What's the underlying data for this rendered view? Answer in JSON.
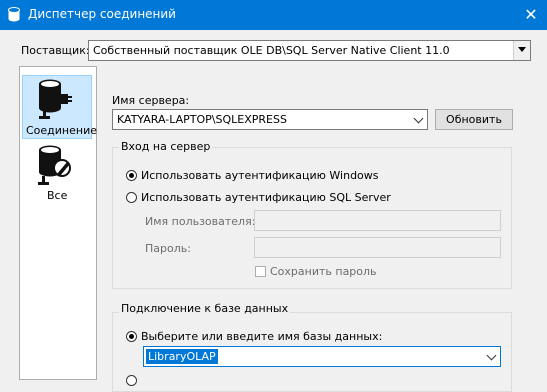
{
  "window": {
    "title": "Диспетчер соединений",
    "close_glyph": "✕"
  },
  "provider": {
    "label": "Поставщик:",
    "value": "Собственный поставщик OLE DB\\SQL Server Native Client 11.0"
  },
  "nav": {
    "items": [
      {
        "label": "Соединение",
        "icon": "database-plug-icon",
        "selected": true
      },
      {
        "label": "Все",
        "icon": "database-wrench-icon",
        "selected": false
      }
    ]
  },
  "server": {
    "label": "Имя сервера:",
    "value": "KATYARA-LAPTOP\\SQLEXPRESS",
    "refresh_button": "Обновить"
  },
  "login": {
    "group_title": "Вход на сервер",
    "windows_auth": "Использовать аутентификацию Windows",
    "sql_auth": "Использовать аутентификацию SQL Server",
    "username_label": "Имя пользователя:",
    "password_label": "Пароль:",
    "save_password": "Сохранить пароль",
    "selected": "windows"
  },
  "database": {
    "group_title": "Подключение к базе данных",
    "select_option": "Выберите или введите имя базы данных:",
    "value": "LibraryOLAP"
  },
  "colors": {
    "titlebar": "#0078d7",
    "selection": "#cce8ff",
    "highlight": "#0078d7"
  }
}
